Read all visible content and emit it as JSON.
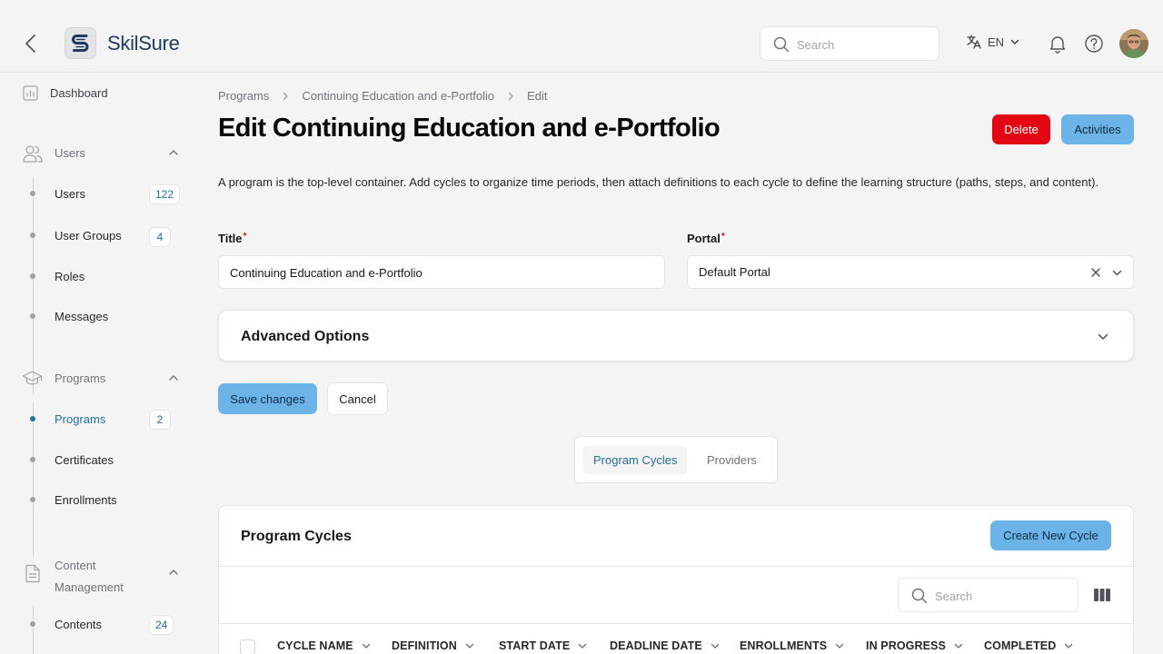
{
  "app": {
    "name": "SkilSure"
  },
  "header": {
    "search_placeholder": "Search",
    "language": "EN"
  },
  "sidebar": {
    "dashboard": "Dashboard",
    "sections": [
      {
        "label": "Users",
        "items": [
          {
            "label": "Users",
            "count": "122"
          },
          {
            "label": "User Groups",
            "count": "4"
          },
          {
            "label": "Roles"
          },
          {
            "label": "Messages"
          }
        ]
      },
      {
        "label": "Programs",
        "items": [
          {
            "label": "Programs",
            "count": "2",
            "active": true
          },
          {
            "label": "Certificates"
          },
          {
            "label": "Enrollments"
          }
        ]
      },
      {
        "label": "Content Management",
        "label_line1": "Content",
        "label_line2": "Management",
        "items": [
          {
            "label": "Contents",
            "count": "24"
          }
        ]
      }
    ]
  },
  "breadcrumb": [
    "Programs",
    "Continuing Education and e-Portfolio",
    "Edit"
  ],
  "page": {
    "title": "Edit Continuing Education and e-Portfolio",
    "delete_label": "Delete",
    "activities_label": "Activities",
    "description": "A program is the top-level container. Add cycles to organize time periods, then attach definitions to each cycle to define the learning structure (paths, steps, and content)."
  },
  "form": {
    "title_label": "Title",
    "title_value": "Continuing Education and e-Portfolio",
    "portal_label": "Portal",
    "portal_value": "Default Portal",
    "required_mark": "*",
    "advanced_label": "Advanced Options",
    "save_label": "Save changes",
    "cancel_label": "Cancel"
  },
  "tabs": [
    {
      "label": "Program Cycles",
      "active": true
    },
    {
      "label": "Providers",
      "active": false
    }
  ],
  "cycles": {
    "title": "Program Cycles",
    "create_label": "Create New Cycle",
    "search_placeholder": "Search",
    "columns": [
      "CYCLE NAME",
      "DEFINITION",
      "START DATE",
      "DEADLINE DATE",
      "ENROLLMENTS",
      "IN PROGRESS",
      "COMPLETED"
    ]
  },
  "colors": {
    "accent": "#1d6fa5",
    "primary_button": "#6cb4e8",
    "danger": "#e30613",
    "background": "#f4f4f5"
  }
}
